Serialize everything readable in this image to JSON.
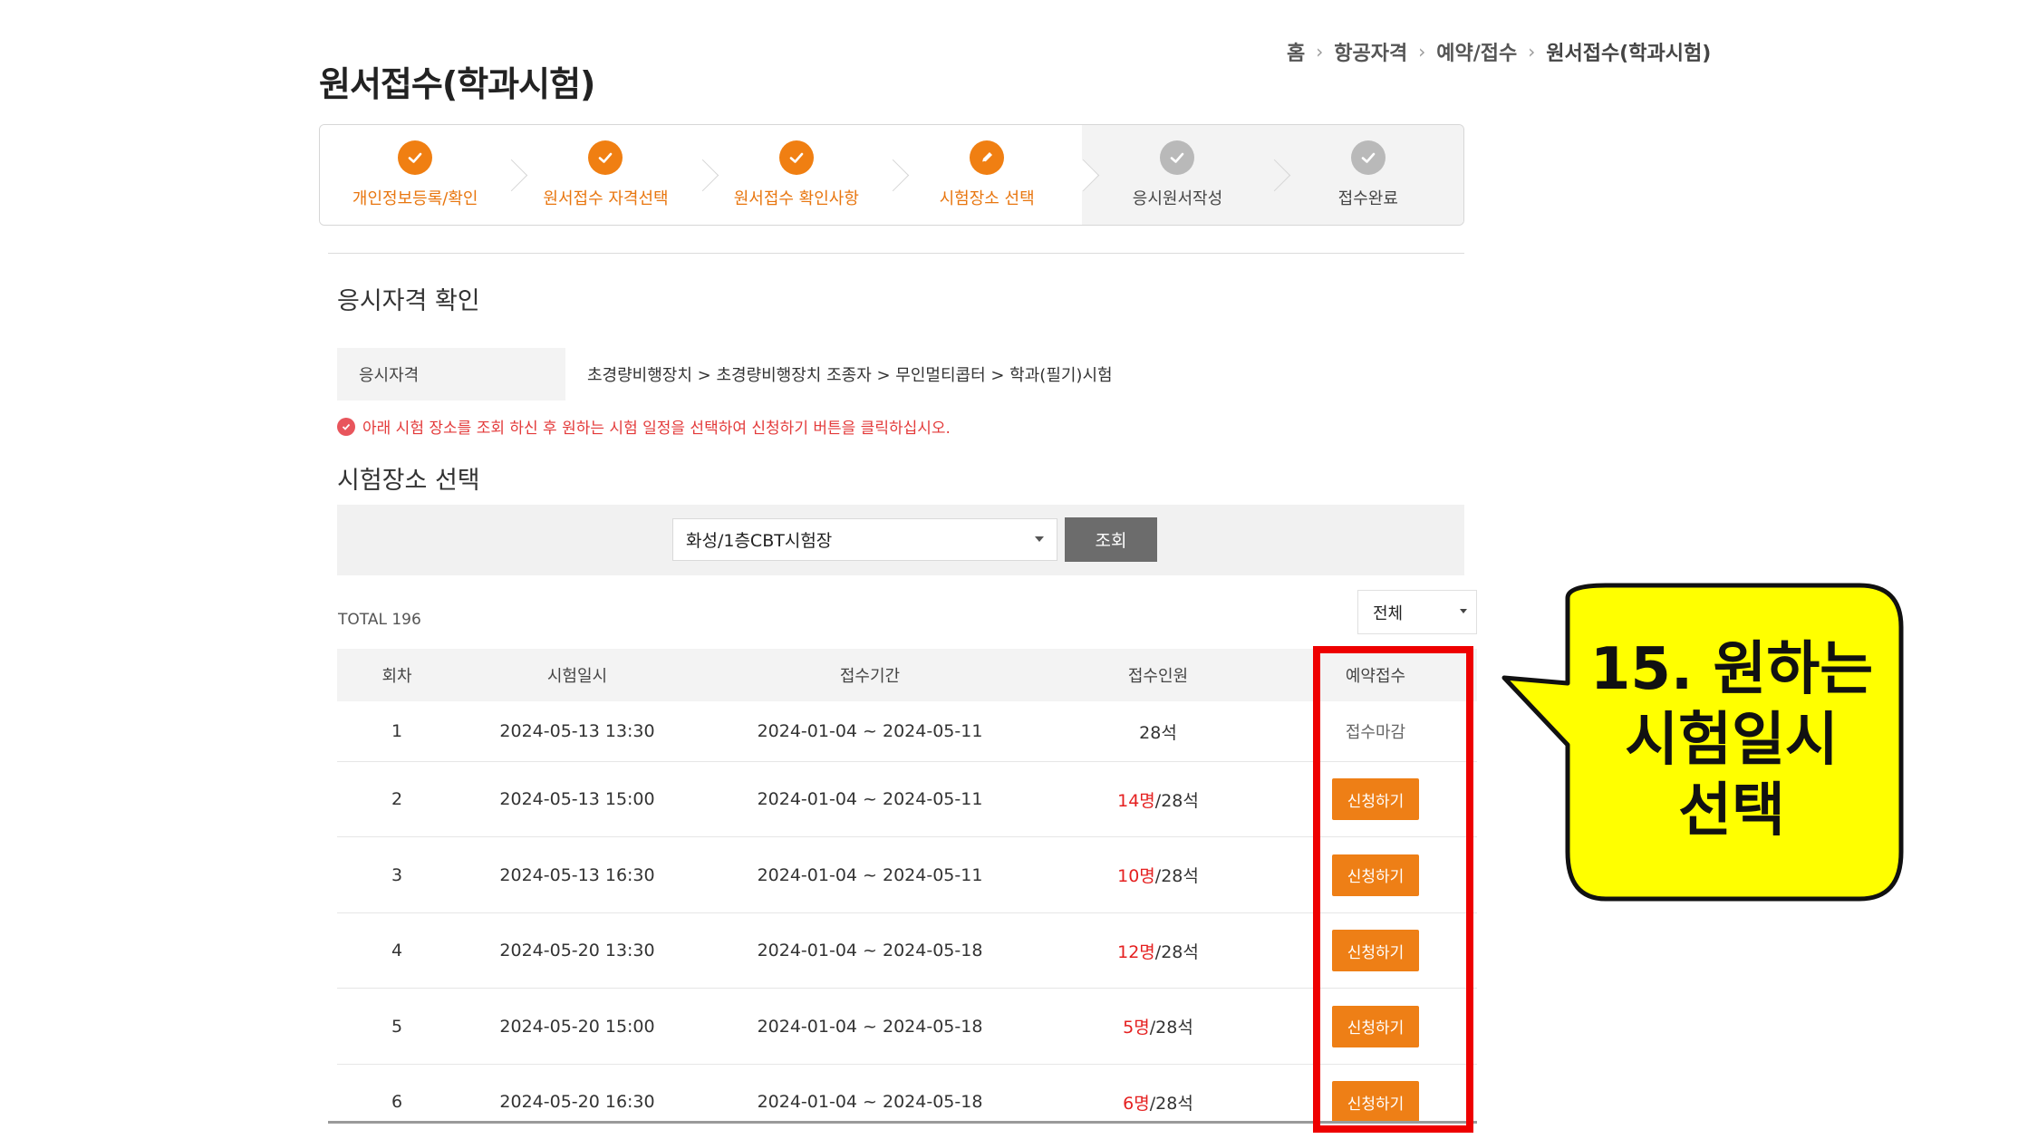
{
  "breadcrumb": [
    "홈",
    "항공자격",
    "예약/접수",
    "원서접수(학과시험)"
  ],
  "page_title": "원서접수(학과시험)",
  "steps": [
    {
      "label": "개인정보등록/확인",
      "state": "done"
    },
    {
      "label": "원서접수 자격선택",
      "state": "done"
    },
    {
      "label": "원서접수 확인사항",
      "state": "done"
    },
    {
      "label": "시험장소 선택",
      "state": "current"
    },
    {
      "label": "응시원서작성",
      "state": "pending"
    },
    {
      "label": "접수완료",
      "state": "pending"
    }
  ],
  "qualification": {
    "title": "응시자격 확인",
    "label": "응시자격",
    "value": "초경량비행장치 > 초경량비행장치 조종자 > 무인멀티콥터 > 학과(필기)시험"
  },
  "notice": "아래 시험 장소를 조회 하신 후 원하는 시험 일정을 선택하여 신청하기 버튼을 클릭하십시오.",
  "venue": {
    "title": "시험장소 선택",
    "selected": "화성/1층CBT시험장",
    "search_label": "조회"
  },
  "total_label": "TOTAL 196",
  "filter_value": "전체",
  "table": {
    "headers": [
      "회차",
      "시험일시",
      "접수기간",
      "접수인원",
      "예약접수"
    ],
    "rows": [
      {
        "round": "1",
        "datetime": "2024-05-13 13:30",
        "period": "2024-01-04 ~ 2024-05-11",
        "count": "",
        "capacity": "28석",
        "action": "접수마감"
      },
      {
        "round": "2",
        "datetime": "2024-05-13 15:00",
        "period": "2024-01-04 ~ 2024-05-11",
        "count": "14명",
        "capacity": "/28석",
        "action": "신청하기"
      },
      {
        "round": "3",
        "datetime": "2024-05-13 16:30",
        "period": "2024-01-04 ~ 2024-05-11",
        "count": "10명",
        "capacity": "/28석",
        "action": "신청하기"
      },
      {
        "round": "4",
        "datetime": "2024-05-20 13:30",
        "period": "2024-01-04 ~ 2024-05-18",
        "count": "12명",
        "capacity": "/28석",
        "action": "신청하기"
      },
      {
        "round": "5",
        "datetime": "2024-05-20 15:00",
        "period": "2024-01-04 ~ 2024-05-18",
        "count": "5명",
        "capacity": "/28석",
        "action": "신청하기"
      },
      {
        "round": "6",
        "datetime": "2024-05-20 16:30",
        "period": "2024-01-04 ~ 2024-05-18",
        "count": "6명",
        "capacity": "/28석",
        "action": "신청하기"
      }
    ]
  },
  "callout": {
    "lines": [
      "15. 원하는",
      "시험일시",
      "선택"
    ]
  },
  "colors": {
    "accent": "#f07f12",
    "highlight": "#ee0000",
    "callout_fill": "#ffff00",
    "count_red": "#e52020"
  }
}
